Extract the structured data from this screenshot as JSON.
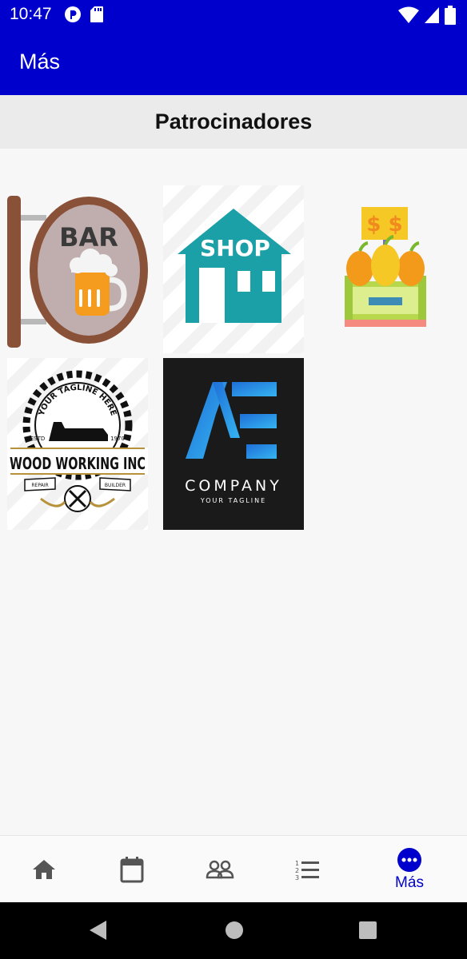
{
  "status_bar": {
    "time": "10:47"
  },
  "app_bar": {
    "title": "Más"
  },
  "section": {
    "title": "Patrocinadores"
  },
  "sponsors": {
    "bar": {
      "text": "BAR"
    },
    "shop": {
      "text": "SHOP"
    },
    "market": {
      "text": "$ $"
    },
    "woodworking": {
      "name": "WOOD WORKING INC",
      "tagline": "YOUR TAGLINE HERE",
      "estd": "ESTD",
      "year": "1970",
      "left_ribbon": "REPAIR",
      "right_ribbon": "BUILDER"
    },
    "company": {
      "name": "COMPANY",
      "tagline": "YOUR TAGLINE"
    }
  },
  "bottom_nav": {
    "items": [
      {
        "icon": "home-icon"
      },
      {
        "icon": "calendar-icon"
      },
      {
        "icon": "people-icon"
      },
      {
        "icon": "list-icon"
      },
      {
        "icon": "more-icon",
        "label": "Más",
        "active": true
      }
    ]
  },
  "colors": {
    "primary": "#0000cc",
    "nav_inactive": "#555555"
  }
}
